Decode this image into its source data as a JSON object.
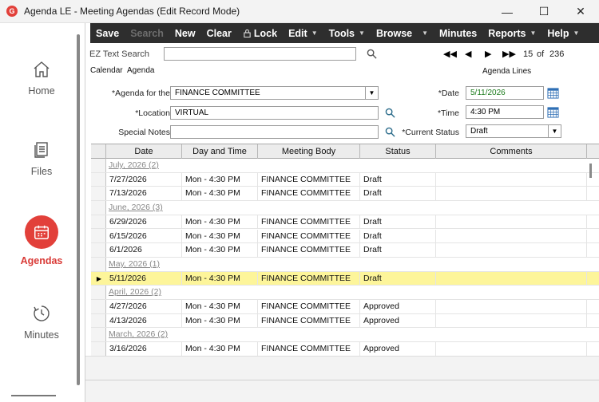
{
  "window": {
    "title": "Agenda LE - Meeting Agendas (Edit Record Mode)",
    "app_icon_letter": "G",
    "minimize": "—",
    "maximize": "☐",
    "close": "✕"
  },
  "sidebar": {
    "items": [
      {
        "label": "Home",
        "icon": "home-icon"
      },
      {
        "label": "Files",
        "icon": "files-icon"
      },
      {
        "label": "Agendas",
        "icon": "calendar-icon"
      },
      {
        "label": "Minutes",
        "icon": "clock-icon"
      }
    ],
    "accent": "#e2403a"
  },
  "menubar": {
    "save": "Save",
    "search": "Search",
    "new": "New",
    "clear": "Clear",
    "lock": "Lock",
    "edit": "Edit",
    "tools": "Tools",
    "browse": "Browse",
    "minutes": "Minutes",
    "reports": "Reports",
    "help": "Help"
  },
  "form": {
    "ez_search_label": "EZ Text Search",
    "ez_search_value": "",
    "record_position": "15",
    "record_of": "of",
    "record_total": "236",
    "tabs": {
      "calendar": "Calendar",
      "agenda": "Agenda",
      "agenda_lines": "Agenda Lines"
    },
    "agenda_for_label": "*Agenda for the",
    "agenda_for_value": "FINANCE COMMITTEE",
    "location_label": "*Location",
    "location_value": "VIRTUAL",
    "special_notes_label": "Special Notes",
    "special_notes_value": "",
    "date_label": "*Date",
    "date_value": "5/11/2026",
    "time_label": "*Time",
    "time_value": "4:30 PM",
    "status_label": "*Current Status",
    "status_value": "Draft",
    "date_color": "#1a7a1a"
  },
  "grid": {
    "columns": [
      "Date",
      "Day and Time",
      "Meeting Body",
      "Status",
      "Comments"
    ],
    "rows": [
      {
        "group": "July, 2026 (2)"
      },
      {
        "date": "7/27/2026",
        "day_time": "Mon - 4:30 PM",
        "body": "FINANCE COMMITTEE",
        "status": "Draft"
      },
      {
        "date": "7/13/2026",
        "day_time": "Mon - 4:30 PM",
        "body": "FINANCE COMMITTEE",
        "status": "Draft"
      },
      {
        "group": "June, 2026 (3)"
      },
      {
        "date": "6/29/2026",
        "day_time": "Mon - 4:30 PM",
        "body": "FINANCE COMMITTEE",
        "status": "Draft"
      },
      {
        "date": "6/15/2026",
        "day_time": "Mon - 4:30 PM",
        "body": "FINANCE COMMITTEE",
        "status": "Draft"
      },
      {
        "date": "6/1/2026",
        "day_time": "Mon - 4:30 PM",
        "body": "FINANCE COMMITTEE",
        "status": "Draft"
      },
      {
        "group": "May, 2026 (1)"
      },
      {
        "date": "5/11/2026",
        "day_time": "Mon - 4:30 PM",
        "body": "FINANCE COMMITTEE",
        "status": "Draft",
        "selected": true
      },
      {
        "group": "April, 2026 (2)"
      },
      {
        "date": "4/27/2026",
        "day_time": "Mon - 4:30 PM",
        "body": "FINANCE COMMITTEE",
        "status": "Approved"
      },
      {
        "date": "4/13/2026",
        "day_time": "Mon - 4:30 PM",
        "body": "FINANCE COMMITTEE",
        "status": "Approved"
      },
      {
        "group": "March, 2026 (2)"
      },
      {
        "date": "3/16/2026",
        "day_time": "Mon - 4:30 PM",
        "body": "FINANCE COMMITTEE",
        "status": "Approved"
      }
    ],
    "selected_color": "#fdf59a"
  }
}
